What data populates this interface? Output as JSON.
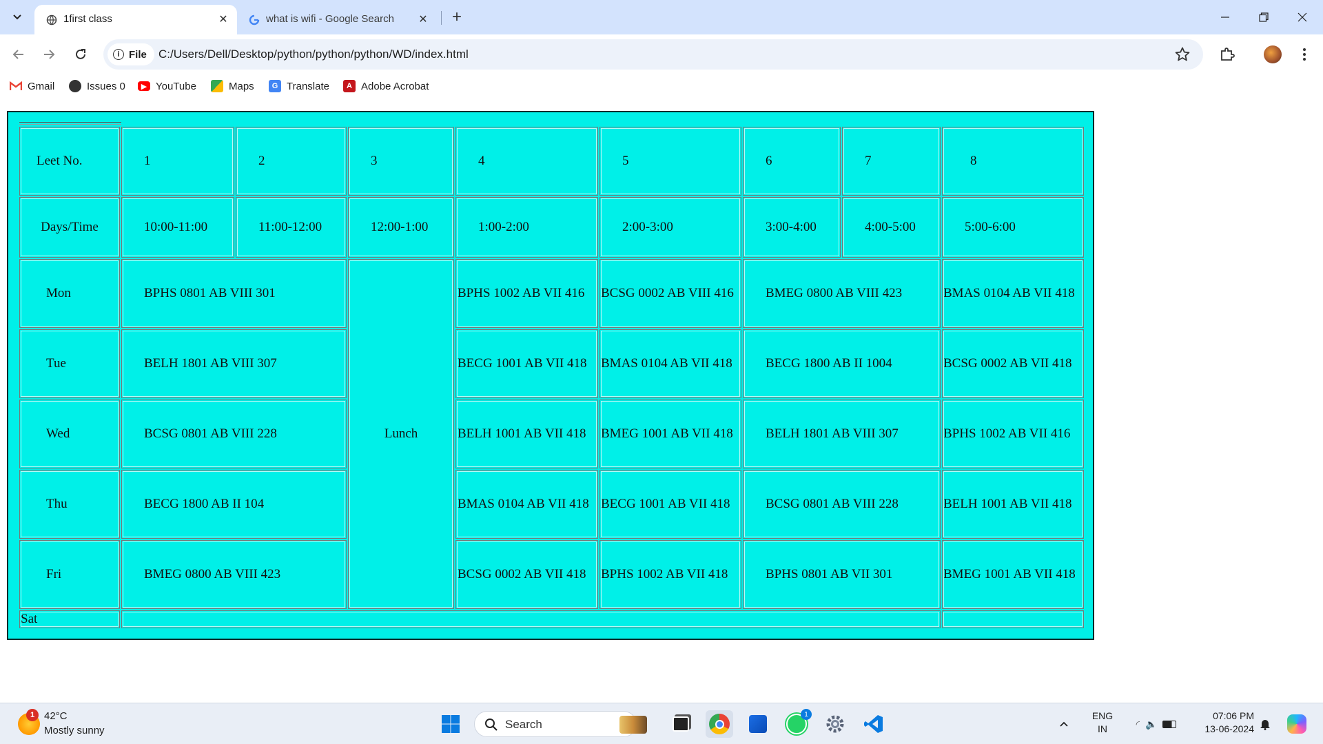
{
  "browser": {
    "tabs": [
      {
        "title": "1first class",
        "favicon": "globe-icon",
        "active": true
      },
      {
        "title": "what is wifi - Google Search",
        "favicon": "google-icon",
        "active": false
      }
    ],
    "omnibox": {
      "chip_label": "File",
      "url": "C:/Users/Dell/Desktop/python/python/python/WD/index.html"
    },
    "bookmarks": [
      "Gmail",
      "Issues 0",
      "YouTube",
      "Maps",
      "Translate",
      "Adobe Acrobat"
    ]
  },
  "timetable": {
    "background_color": "#00f0e8",
    "lect_label": "Leet No.",
    "lect_numbers": [
      "1",
      "2",
      "3",
      "4",
      "5",
      "6",
      "7",
      "8"
    ],
    "time_label": "Days/Time",
    "times": [
      "10:00-11:00",
      "11:00-12:00",
      "12:00-1:00",
      "1:00-2:00",
      "2:00-3:00",
      "3:00-4:00",
      "4:00-5:00",
      "5:00-6:00"
    ],
    "lunch_label": "Lunch",
    "rows": [
      {
        "day": "Mon",
        "slot12": "BPHS 0801 AB VIII 301",
        "slot4": "BPHS 1002 AB VII 416",
        "slot5": "BCSG 0002 AB VIII 416",
        "slot67": "BMEG 0800 AB VIII 423",
        "slot8": "BMAS 0104 AB VII 418"
      },
      {
        "day": "Tue",
        "slot12": "BELH 1801 AB VIII 307",
        "slot4": "BECG 1001 AB VII 418",
        "slot5": "BMAS 0104 AB VII 418",
        "slot67": "BECG 1800 AB II 1004",
        "slot8": "BCSG 0002 AB VII 418"
      },
      {
        "day": "Wed",
        "slot12": "BCSG 0801 AB VIII 228",
        "slot4": "BELH 1001 AB VII 418",
        "slot5": "BMEG 1001 AB VII 418",
        "slot67": "BELH 1801 AB VIII 307",
        "slot8": "BPHS 1002 AB VII 416"
      },
      {
        "day": "Thu",
        "slot12": "BECG 1800 AB II 104",
        "slot4": "BMAS 0104 AB VII 418",
        "slot5": "BECG 1001 AB VII 418",
        "slot67": "BCSG 0801 AB VIII 228",
        "slot8": "BELH 1001 AB VII 418"
      },
      {
        "day": "Fri",
        "slot12": "BMEG 0800 AB VIII 423",
        "slot4": "BCSG 0002 AB VII 418",
        "slot5": "BPHS 1002 AB VII 418",
        "slot67": "BPHS 0801 AB VII 301",
        "slot8": "BMEG 1001 AB VII 418"
      }
    ],
    "sat_label": "Sat"
  },
  "taskbar": {
    "weather": {
      "temp": "42°C",
      "desc": "Mostly sunny",
      "badge": "1"
    },
    "search_label": "Search",
    "whatsapp_badge": "1",
    "lang_line1": "ENG",
    "lang_line2": "IN",
    "time": "07:06 PM",
    "date": "13-06-2024"
  }
}
